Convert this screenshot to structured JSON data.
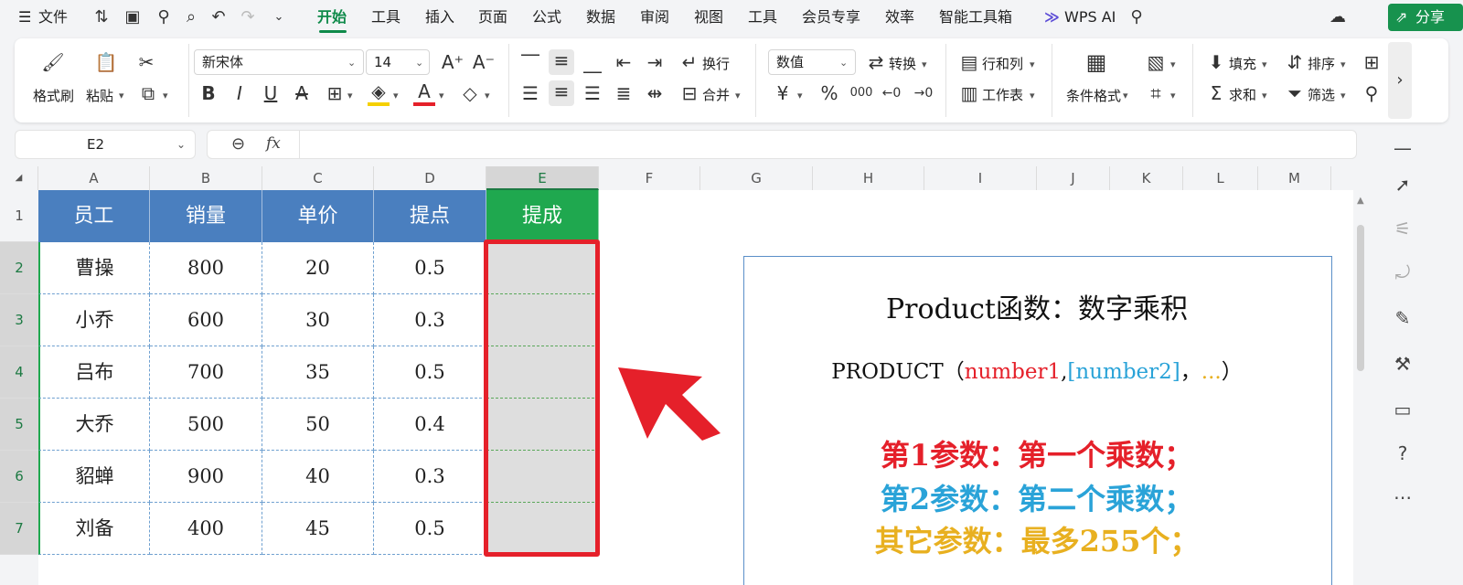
{
  "menubar": {
    "file": "文件",
    "tabs": [
      "开始",
      "工具",
      "插入",
      "页面",
      "公式",
      "数据",
      "审阅",
      "视图",
      "工具",
      "会员专享",
      "效率",
      "智能工具箱"
    ],
    "active_tab": "开始",
    "wps_ai": "WPS AI",
    "share": "分享"
  },
  "ribbon": {
    "format_painter": "格式刷",
    "paste": "粘贴",
    "font_name": "新宋体",
    "font_size": "14",
    "wrap": "换行",
    "merge": "合并",
    "number_format": "数值",
    "convert": "转换",
    "row_col": "行和列",
    "worksheet": "工作表",
    "conditional_format": "条件格式",
    "fill": "填充",
    "sort": "排序",
    "sum": "求和",
    "filter": "筛选",
    "percent": "%",
    "thousands": "000"
  },
  "formula_bar": {
    "cell_ref": "E2",
    "fx": "fx",
    "value": ""
  },
  "columns": [
    "A",
    "B",
    "C",
    "D",
    "E",
    "F",
    "G",
    "H",
    "I",
    "J",
    "K",
    "L",
    "M"
  ],
  "selected_column": "E",
  "rows": [
    "1",
    "2",
    "3",
    "4",
    "5",
    "6",
    "7"
  ],
  "table": {
    "headers": [
      "员工",
      "销量",
      "单价",
      "提点",
      "提成"
    ],
    "data": [
      [
        "曹操",
        "800",
        "20",
        "0.5",
        ""
      ],
      [
        "小乔",
        "600",
        "30",
        "0.3",
        ""
      ],
      [
        "吕布",
        "700",
        "35",
        "0.5",
        ""
      ],
      [
        "大乔",
        "500",
        "50",
        "0.4",
        ""
      ],
      [
        "貂蝉",
        "900",
        "40",
        "0.3",
        ""
      ],
      [
        "刘备",
        "400",
        "45",
        "0.5",
        ""
      ]
    ]
  },
  "info": {
    "title": "Product函数：数字乘积",
    "syntax_fn": "PRODUCT（",
    "syntax_arg1": "number1",
    "syntax_sep1": ",",
    "syntax_arg2": "[number2]",
    "syntax_sep2": "，",
    "syntax_rest": "...",
    "syntax_close": "）",
    "line1": "第1参数：第一个乘数；",
    "line2": "第2参数：第二个乘数；",
    "line3": "其它参数：最多255个；"
  },
  "colors": {
    "header_blue": "#4a7fbf",
    "header_green": "#1fa84f",
    "red": "#e5202a",
    "cyan": "#2aa3d8",
    "gold": "#e8b020",
    "accent_green": "#0f8a4a"
  }
}
